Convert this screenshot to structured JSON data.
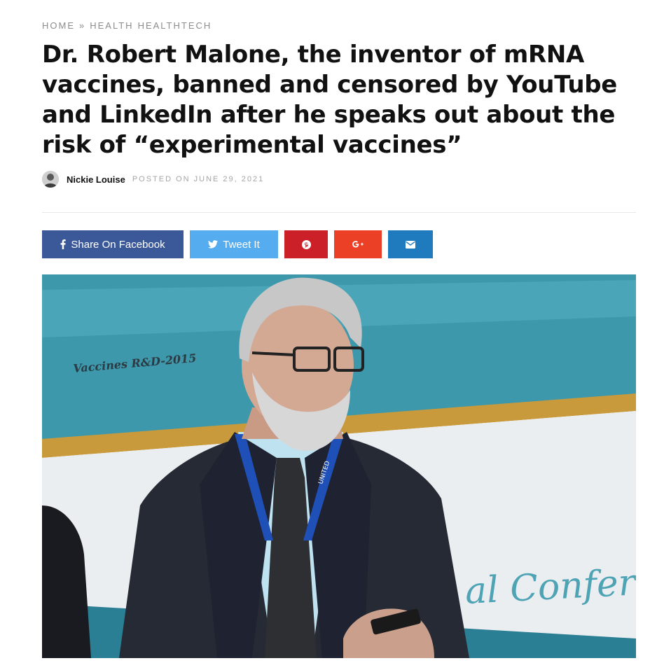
{
  "breadcrumb": {
    "home": "HOME",
    "separator": "»",
    "category_1": "HEALTH",
    "category_2": "HEALTHTECH"
  },
  "article": {
    "title": "Dr. Robert Malone, the inventor of mRNA vaccines, banned and censored by YouTube and LinkedIn after he speaks out about the risk of “experimental vaccines”",
    "author": "Nickie Louise",
    "posted": "POSTED ON JUNE 29, 2021"
  },
  "share": {
    "facebook_label": "Share On Facebook",
    "twitter_label": "Tweet It",
    "facebook_icon": "facebook-icon",
    "twitter_icon": "twitter-icon",
    "pinterest_icon": "pinterest-icon",
    "googleplus_icon": "google-plus-icon",
    "email_icon": "envelope-icon",
    "colors": {
      "facebook": "#3b5998",
      "twitter": "#55acee",
      "pinterest": "#cb2027",
      "googleplus": "#eb4026",
      "email": "#1f7bbd"
    }
  },
  "hero_image": {
    "banner_text": "Vaccines R&D-2015",
    "script_text": "al Confer",
    "lanyard_text": "UNITED"
  }
}
